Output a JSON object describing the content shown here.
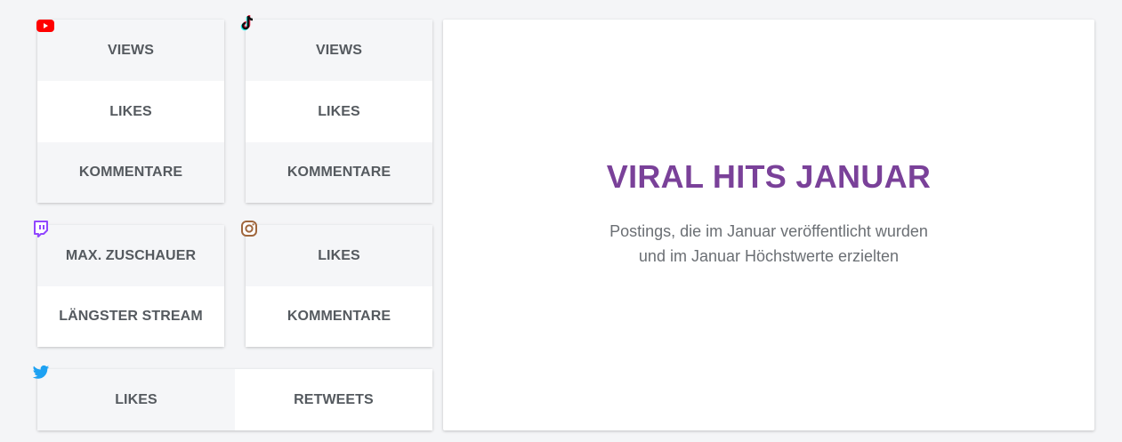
{
  "youtube": {
    "icon": "youtube-icon",
    "metrics": [
      "VIEWS",
      "LIKES",
      "KOMMENTARE"
    ]
  },
  "tiktok": {
    "icon": "tiktok-icon",
    "metrics": [
      "VIEWS",
      "LIKES",
      "KOMMENTARE"
    ]
  },
  "twitch": {
    "icon": "twitch-icon",
    "metrics": [
      "MAX. ZUSCHAUER",
      "LÄNGSTER STREAM"
    ]
  },
  "instagram": {
    "icon": "instagram-icon",
    "metrics": [
      "LIKES",
      "KOMMENTARE"
    ]
  },
  "twitter": {
    "icon": "twitter-icon",
    "metrics": [
      "LIKES",
      "RETWEETS"
    ]
  },
  "hero": {
    "title": "VIRAL HITS JANUAR",
    "subtitle_line1": "Postings, die im Januar veröffentlicht wurden",
    "subtitle_line2": "und im Januar Höchstwerte erzielten"
  },
  "colors": {
    "accent": "#7a4199",
    "youtube": "#ff0000",
    "twitch": "#9146ff",
    "instagram": "#a0673d",
    "twitter": "#1da1f2"
  }
}
